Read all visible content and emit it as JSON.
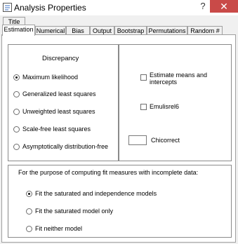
{
  "window": {
    "title": "Analysis Properties",
    "help_glyph": "?",
    "close_glyph": "✕"
  },
  "tabs": {
    "row1": [
      "Title"
    ],
    "row2": [
      "Estimation",
      "Numerical",
      "Bias",
      "Output",
      "Bootstrap",
      "Permutations",
      "Random #"
    ],
    "active": "Estimation"
  },
  "discrepancy": {
    "heading": "Discrepancy",
    "options": [
      {
        "label": "Maximum likelihood",
        "selected": true
      },
      {
        "label": "Generalized least squares",
        "selected": false
      },
      {
        "label": "Unweighted least squares",
        "selected": false
      },
      {
        "label": "Scale-free least squares",
        "selected": false
      },
      {
        "label": "Asymptotically distribution-free",
        "selected": false
      }
    ]
  },
  "options": {
    "estimate_means": {
      "label": "Estimate means and intercepts",
      "line1": "Estimate means and",
      "line2": "intercepts",
      "checked": false
    },
    "emulisrel6": {
      "label": "Emulisrel6",
      "checked": false
    },
    "chicorrect": {
      "label": "Chicorrect",
      "value": ""
    }
  },
  "incomplete": {
    "heading": "For the purpose of computing fit measures with incomplete data:",
    "options": [
      {
        "label": "Fit the saturated and independence models",
        "selected": true
      },
      {
        "label": "Fit the saturated model only",
        "selected": false
      },
      {
        "label": "Fit neither model",
        "selected": false
      }
    ]
  }
}
